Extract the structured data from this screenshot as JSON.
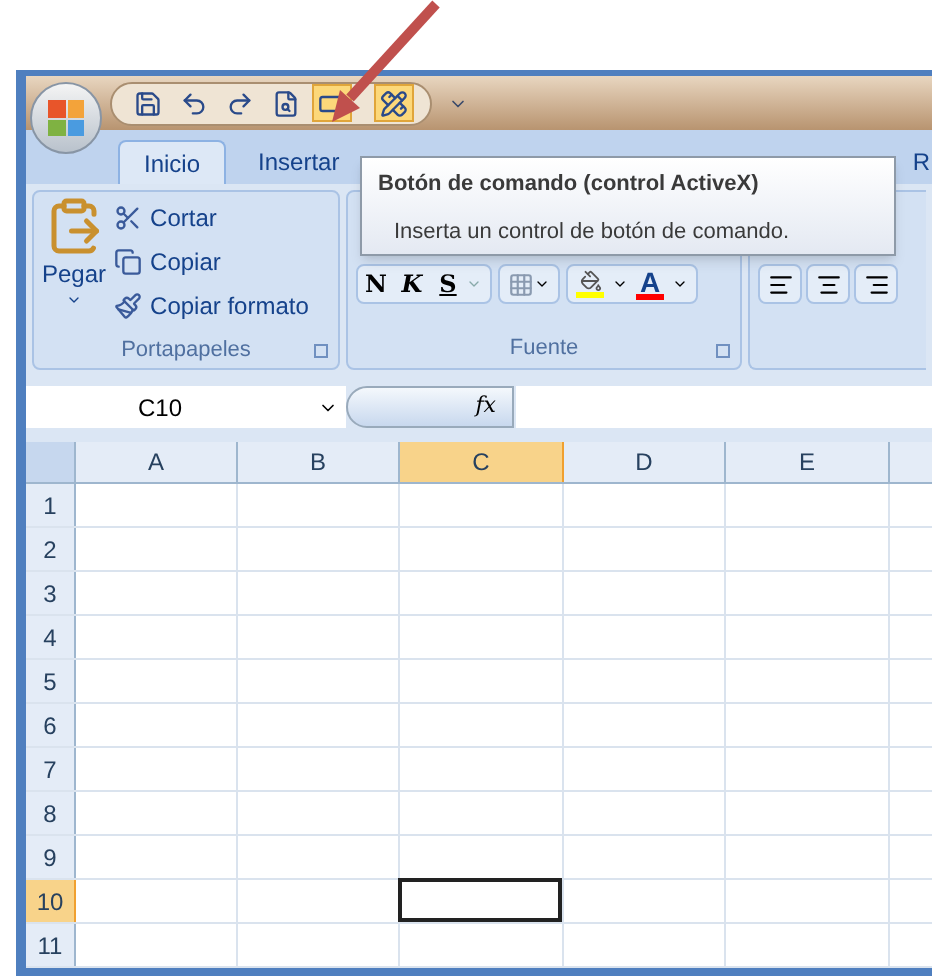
{
  "quick_access": [
    {
      "kind": "save",
      "highlighted": false
    },
    {
      "kind": "undo",
      "highlighted": false
    },
    {
      "kind": "redo",
      "highlighted": false
    },
    {
      "kind": "preview",
      "highlighted": false
    },
    {
      "kind": "command-button",
      "highlighted": true
    },
    {
      "kind": "design",
      "highlighted": true
    }
  ],
  "tabs": [
    {
      "label": "Inicio",
      "selected": true
    },
    {
      "label": "Insertar",
      "selected": false
    },
    {
      "label": "R",
      "selected": false
    }
  ],
  "tooltip": {
    "title": "Botón de comando (control ActiveX)",
    "description": "Inserta un control de botón de comando."
  },
  "clipboard": {
    "paste": "Pegar",
    "items": [
      {
        "kind": "cut",
        "label": "Cortar"
      },
      {
        "kind": "copy",
        "label": "Copiar"
      },
      {
        "kind": "format",
        "label": "Copiar formato"
      }
    ],
    "label": "Portapapeles"
  },
  "font": {
    "bold": "N",
    "italic": "K",
    "underline": "S",
    "font_color": "A",
    "label": "Fuente"
  },
  "name_box": "C10",
  "formula_icon": "fx",
  "columns": [
    {
      "label": "A",
      "selected": false
    },
    {
      "label": "B",
      "selected": false
    },
    {
      "label": "C",
      "selected": true
    },
    {
      "label": "D",
      "selected": false
    },
    {
      "label": "E",
      "selected": false
    }
  ],
  "rows": [
    {
      "label": "1",
      "selected": false
    },
    {
      "label": "2",
      "selected": false
    },
    {
      "label": "3",
      "selected": false
    },
    {
      "label": "4",
      "selected": false
    },
    {
      "label": "5",
      "selected": false
    },
    {
      "label": "6",
      "selected": false
    },
    {
      "label": "7",
      "selected": false
    },
    {
      "label": "8",
      "selected": false
    },
    {
      "label": "9",
      "selected": false
    },
    {
      "label": "10",
      "selected": true
    },
    {
      "label": "11",
      "selected": false
    }
  ]
}
